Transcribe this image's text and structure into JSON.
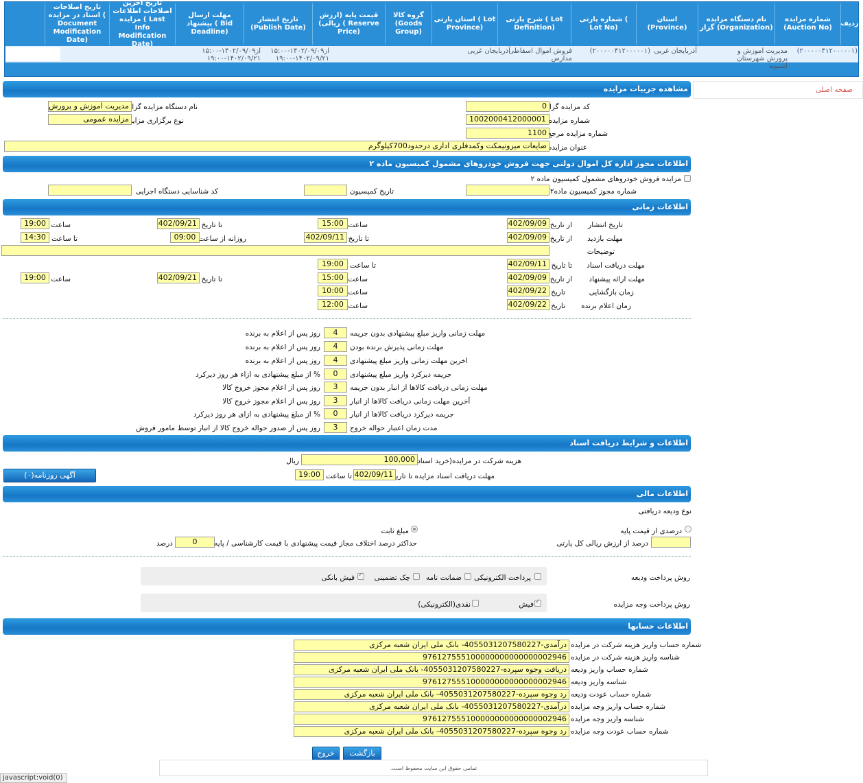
{
  "top_table": {
    "headers": [
      "ردیف",
      "شماره مزایده (Auction No)",
      "نام دستگاه مزایده گزار (Organization)",
      "استان (Province)",
      "شماره پارتی ( Lot No)",
      "شرح پارتی ( Lot Definition)",
      "استان پارتی ( Lot Province)",
      "گروه کالا (Goods Group)",
      "قیمت پایه (ارزش ریالی) ( Reserve Price)",
      "تاریخ انتشار (Publish Date)",
      "مهلت ارسال پیشنهاد ( Bid Deadline)",
      "تاریخ آخرین اصلاحات اطلاعات مزایده ( Last Info Modification Date)",
      "تاریخ اصلاحات اسناد در مزایده ( Document Modification Date)"
    ],
    "row": {
      "auction_no": "(۲۰۰۰۰۰۴۱۲۰۰۰۰۰۱)",
      "organization": "مدیریت اموزش و پرورش شهرستان اشنویه",
      "province": "آذربایجان غربی",
      "lot_no": "(۲۰۰۰۰۰۴۱۲۰۰۰۰۰۱)",
      "lot_definition": "فروش اموال اسقاطی مدارس",
      "lot_province": "آذربایجان غربی",
      "publish_date": "از۱۴۰۲/۰۹/۰۹-۱۵:۰۰ ۱۴۰۲/۰۹/۲۱-۱۹:۰۰",
      "deadline": "از۱۴۰۲/۰۹/۰۹-۱۵:۰۰ ۱۴۰۲/۰۹/۲۱-۱۹:۰۰"
    }
  },
  "home_link": "صفحه اصلی",
  "sections": {
    "details": "مشاهده جزییات مزایده",
    "permit": "اطلاعات مجوز اداره کل اموال دولتی جهت فروش خودروهای مشمول کمیسیون ماده ۲",
    "timing": "اطلاعات زمانی",
    "docs": "اطلاعات و شرایط دریافت اسناد",
    "financial": "اطلاعات مالی",
    "accounts": "اطلاعات حسابها"
  },
  "details": {
    "auctioneer_code_label": "کد مزایده گزار",
    "auctioneer_code": "0",
    "org_name_label": "نام دستگاه مزایده گزار",
    "org_name": "مدیریت اموزش و پرورش ش",
    "auction_no_label": "شماره مزایده",
    "auction_no": "1002000412000001",
    "type_label": "نوع برگزاری مزایده",
    "type": "مزایده عمومی",
    "ref_no_label": "شماره مزایده مرجع",
    "ref_no": "1100",
    "title_label": "عنوان مزایده",
    "title": "ضایعات میزونیمکت وکمدفلزی اداری درحدود700کیلوگرم"
  },
  "permit": {
    "checkbox_label": "مزایده فروش خودروهای مشمول کمیسیون ماده ۲",
    "permit_no_label": "شماره مجوز کمیسیون ماده۲",
    "permit_no": "",
    "commission_date_label": "تاریخ کمیسیون",
    "commission_date": "",
    "exec_id_label": "کد شناسایی دستگاه اجرایی",
    "exec_id": ""
  },
  "timing": {
    "from_date": "از تاریخ",
    "to_date": "تا تاریخ",
    "date": "تاریخ",
    "time": "ساعت",
    "to_time": "تا ساعت",
    "daily_from": "روزانه از ساعت",
    "publish_label": "تاریخ انتشار",
    "publish_from": "1402/09/09",
    "publish_from_time": "15:00",
    "publish_to": "1402/09/21",
    "publish_to_time": "19:00",
    "visit_label": "مهلت بازدید",
    "visit_from": "1402/09/09",
    "visit_to": "1402/09/11",
    "visit_daily_from": "09:00",
    "visit_to_time": "14:30",
    "desc_label": "توضیحات",
    "desc": "",
    "docs_label": "مهلت دریافت اسناد",
    "docs_to": "1402/09/11",
    "docs_to_time": "19:00",
    "offer_label": "مهلت ارائه پیشنهاد",
    "offer_from": "1402/09/09",
    "offer_from_time": "15:00",
    "offer_to": "1402/09/21",
    "offer_to_time": "19:00",
    "opening_label": "زمان بازگشایی",
    "opening_date": "1402/09/22",
    "opening_time": "10:00",
    "winner_label": "زمان اعلام برنده",
    "winner_date": "1402/09/22",
    "winner_time": "12:00"
  },
  "deadlines": [
    {
      "label": "مهلت زمانی واریز مبلغ پیشنهادی بدون جریمه",
      "value": "4",
      "suffix": "روز پس از اعلام به برنده"
    },
    {
      "label": "مهلت زمانی پذیرش برنده بودن",
      "value": "4",
      "suffix": "روز پس از اعلام به برنده"
    },
    {
      "label": "اخرین مهلت زمانی واریز مبلغ پیشنهادی",
      "value": "4",
      "suffix": "روز پس از اعلام به برنده"
    },
    {
      "label": "جریمه دیرکرد واریز مبلغ پیشنهادی",
      "value": "0",
      "suffix": "% از مبلغ پیشنهادی به ازاء هر روز دیرکرد"
    },
    {
      "label": "مهلت زمانی دریافت کالاها از انبار بدون جریمه",
      "value": "3",
      "suffix": "روز پس از اعلام مجوز خروج کالا"
    },
    {
      "label": "آخرین مهلت زمانی دریافت کالاها از انبار",
      "value": "3",
      "suffix": "روز پس از اعلام مجوز خروج کالا"
    },
    {
      "label": "جریمه دیرکرد دریافت کالاها از انبار",
      "value": "0",
      "suffix": "% از مبلغ پیشنهادی به ازای هر روز دیرکرد"
    },
    {
      "label": "مدت زمان اعتبار حواله خروج",
      "value": "3",
      "suffix": "روز پس از صدور حواله خروج کالا از انبار توسط مامور فروش"
    }
  ],
  "docs": {
    "fee_label": "هزینه شرکت در مزایده(خرید اسناد)",
    "fee": "100,000",
    "currency": "ریال",
    "docs_deadline_label": "مهلت دریافت اسناد مزایده تا تاریخ",
    "docs_deadline_date": "1402/09/11",
    "to_time": "تا ساعت",
    "docs_deadline_time": "19:00",
    "newspaper_button": "آگهی روزنامه(۰)"
  },
  "financial": {
    "deposit_type_label": "نوع ودیعه دریافتی",
    "percent_base_label": "درصدی از قیمت پایه",
    "fixed_label": "مبلغ ثابت",
    "percent_total_label": "درصد از ارزش ریالی کل پارتی",
    "percent_total": "",
    "max_diff_label": "حداکثر درصد اختلاف مجاز قیمت پیشنهادی با قیمت کارشناسی / پایه",
    "max_diff": "0",
    "percent_unit": "درصد",
    "deposit_method_label": "روش پرداخت ودیعه",
    "deposit_methods": [
      {
        "label": "پرداخت الکترونیکی",
        "checked": false
      },
      {
        "label": "ضمانت نامه",
        "checked": false
      },
      {
        "label": "چک تضمینی",
        "checked": false
      },
      {
        "label": "فیش بانکی",
        "checked": true
      }
    ],
    "payment_method_label": "روش پرداخت وجه مزایده",
    "payment_methods": [
      {
        "label": "فیش",
        "checked": true
      },
      {
        "label": "نقدی(الکترونیکی)",
        "checked": false
      }
    ]
  },
  "accounts": [
    {
      "label": "شماره حساب واریز هزینه شرکت در مزایده",
      "value": "درآمدی-4055031207580227- بانک ملی ایران شعبه مرکزی"
    },
    {
      "label": "شناسه واریز هزینه شرکت در مزایده",
      "value": "976127555100000000000000002946"
    },
    {
      "label": "شماره حساب واریز ودیعه",
      "value": "دریافت وجوه سپرده-4055031207580227- بانک ملی ایران شعبه مرکزی"
    },
    {
      "label": "شناسه واریز ودیعه",
      "value": "976127555100000000000000002946"
    },
    {
      "label": "شماره حساب عودت ودیعه",
      "value": "رد وجوه سپرده-4055031207580227- بانک ملی ایران شعبه مرکزی"
    },
    {
      "label": "شماره حساب واریز وجه مزایده",
      "value": "درآمدی-4055031207580227- بانک ملی ایران شعبه مرکزی"
    },
    {
      "label": "شناسه واریز وجه مزایده",
      "value": "976127555100000000000000002946"
    },
    {
      "label": "شماره حساب عودت وجه مزایده",
      "value": "رد وجوه سپرده-4055031207580227- بانک ملی ایران شعبه مرکزی"
    }
  ],
  "buttons": {
    "back": "بازگشت",
    "exit": "خروج"
  },
  "footer": "تمامی حقوق این سایت محفوظ است.",
  "status_bar": "javascript:void(0)"
}
